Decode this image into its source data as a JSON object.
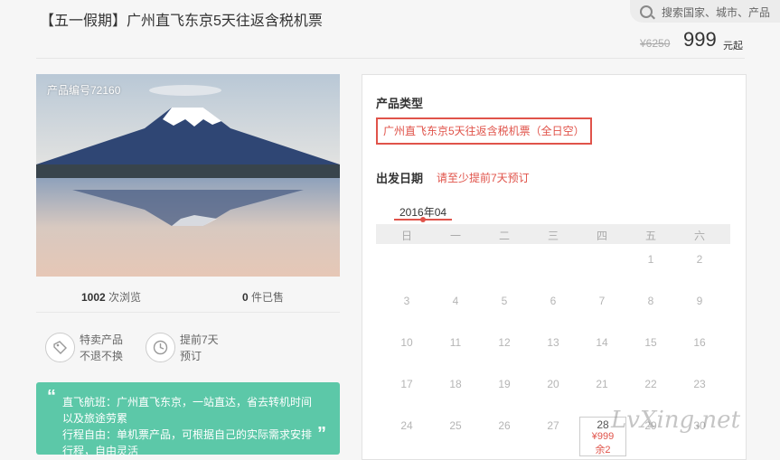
{
  "header": {
    "title": "【五一假期】广州直飞东京5天往返含税机票",
    "search_placeholder": "搜索国家、城市、产品",
    "original_price": "¥6250",
    "price": "999",
    "price_unit": "元起"
  },
  "product": {
    "code_label": "产品编号72160",
    "views_count": "1002",
    "views_label": "次浏览",
    "sold_count": "0",
    "sold_label": "件已售",
    "features": [
      {
        "icon": "tag-icon",
        "line1": "特卖产品",
        "line2": "不退不换"
      },
      {
        "icon": "clock-icon",
        "line1": "提前7天",
        "line2": "预订"
      }
    ],
    "note": {
      "open_quote": "“",
      "close_quote": "”",
      "lines": [
        "直飞航班：广州直飞东京，一站直达，省去转机时间",
        "以及旅途劳累",
        "行程自由：单机票产品，可根据自己的实际需求安排",
        "行程，自由灵活"
      ]
    }
  },
  "booking": {
    "type_heading": "产品类型",
    "type_option": "广州直飞东京5天往返含税机票（全日空）",
    "date_heading": "出发日期",
    "date_note": "请至少提前7天预订",
    "month": "2016年04",
    "weekdays": [
      "日",
      "一",
      "二",
      "三",
      "四",
      "五",
      "六"
    ],
    "weeks": [
      [
        "",
        "",
        "",
        "",
        "",
        "1",
        "2"
      ],
      [
        "3",
        "4",
        "5",
        "6",
        "7",
        "8",
        "9"
      ],
      [
        "10",
        "11",
        "12",
        "13",
        "14",
        "15",
        "16"
      ],
      [
        "17",
        "18",
        "19",
        "20",
        "21",
        "22",
        "23"
      ],
      [
        "24",
        "25",
        "26",
        "27",
        "",
        "29",
        "30"
      ]
    ],
    "available_day": {
      "day": "28",
      "price": "¥999",
      "remaining": "余2"
    }
  },
  "watermark": "LvXing.net",
  "colors": {
    "accent": "#e0534a",
    "note_bg": "#5cc8a8"
  }
}
